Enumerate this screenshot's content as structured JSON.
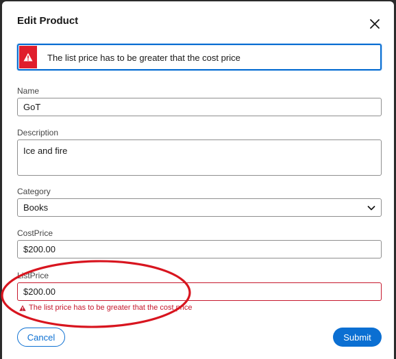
{
  "dialog": {
    "title": "Edit Product"
  },
  "alert": {
    "message": "The list price has to be greater that the cost price",
    "color": "#e01e2c"
  },
  "form": {
    "name": {
      "label": "Name",
      "value": "GoT"
    },
    "description": {
      "label": "Description",
      "value": "Ice and fire"
    },
    "category": {
      "label": "Category",
      "value": "Books"
    },
    "cost_price": {
      "label": "CostPrice",
      "value": "$200.00"
    },
    "list_price": {
      "label": "ListPrice",
      "value": "$200.00",
      "error": "The list price has to be greater that the cost price"
    }
  },
  "buttons": {
    "cancel": "Cancel",
    "submit": "Submit"
  },
  "colors": {
    "accent": "#0b6fd2",
    "error": "#c5162b",
    "annotation": "#d8151f"
  },
  "icons": {
    "close": "close-icon",
    "alert": "warning-icon",
    "select": "chevron-down-icon"
  }
}
